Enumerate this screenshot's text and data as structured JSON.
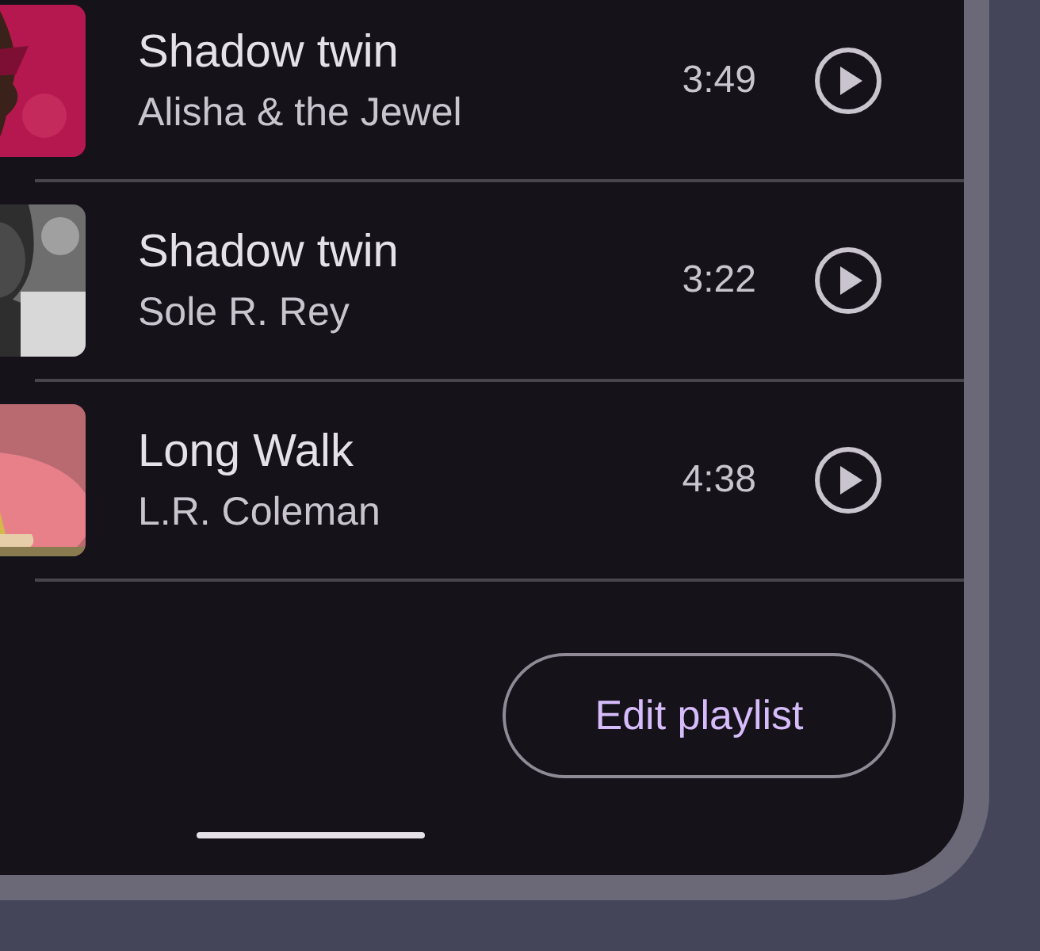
{
  "tracks": [
    {
      "title": "Shadow twin",
      "artist": "Alisha & the Jewel",
      "duration": "3:49"
    },
    {
      "title": "Shadow twin",
      "artist": "Sole R. Rey",
      "duration": "3:22"
    },
    {
      "title": "Long Walk",
      "artist": "L.R. Coleman",
      "duration": "4:38"
    }
  ],
  "button": {
    "label": "Edit playlist"
  }
}
